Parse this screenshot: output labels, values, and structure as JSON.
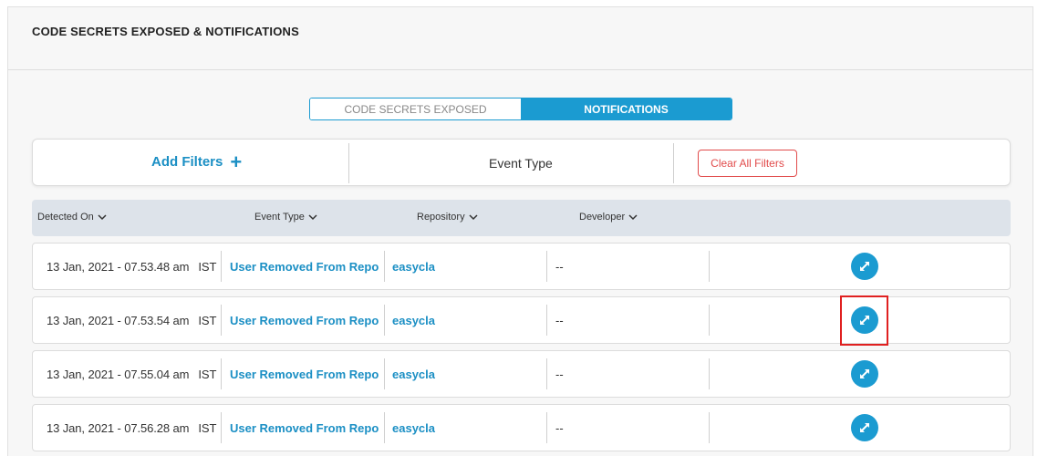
{
  "panel": {
    "title": "CODE SECRETS EXPOSED & NOTIFICATIONS"
  },
  "toggle": {
    "inactive_label": "CODE SECRETS EXPOSED",
    "active_label": "NOTIFICATIONS"
  },
  "filters": {
    "add_label": "Add Filters",
    "event_type_label": "Event Type",
    "clear_label": "Clear All Filters"
  },
  "table": {
    "columns": [
      "Detected On",
      "Event Type",
      "Repository",
      "Developer"
    ],
    "rows": [
      {
        "date": "13 Jan, 2021 - 07.53.48 am",
        "tz": "IST",
        "event": "User Removed From Repo",
        "repo": "easycla",
        "developer": "--"
      },
      {
        "date": "13 Jan, 2021 - 07.53.54 am",
        "tz": "IST",
        "event": "User Removed From Repo",
        "repo": "easycla",
        "developer": "--"
      },
      {
        "date": "13 Jan, 2021 - 07.55.04 am",
        "tz": "IST",
        "event": "User Removed From Repo",
        "repo": "easycla",
        "developer": "--"
      },
      {
        "date": "13 Jan, 2021 - 07.56.28 am",
        "tz": "IST",
        "event": "User Removed From Repo",
        "repo": "easycla",
        "developer": "--"
      }
    ]
  },
  "colors": {
    "accent": "#1b9bd1",
    "danger": "#e14b4b",
    "header_bg": "#dde3ea"
  }
}
